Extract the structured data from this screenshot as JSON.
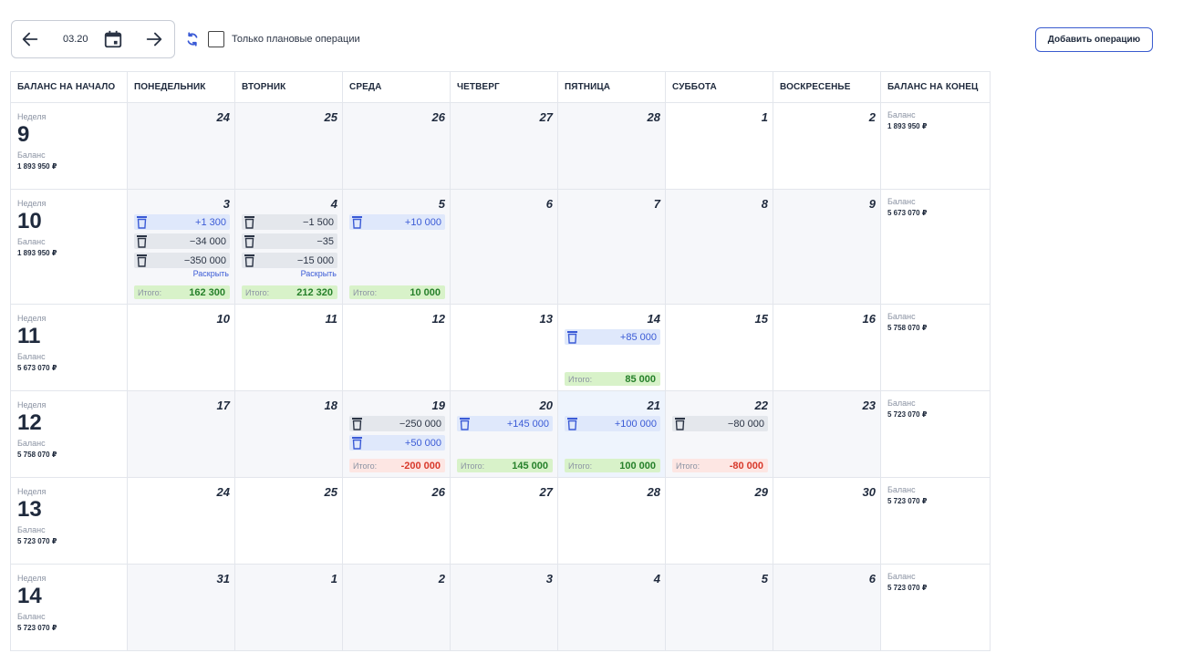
{
  "toolbar": {
    "period": "03.20",
    "only_planned_label": "Только плановые операции",
    "add_operation_label": "Добавить операцию"
  },
  "headers": [
    "БАЛАНС НА НАЧАЛО",
    "ПОНЕДЕЛЬНИК",
    "ВТОРНИК",
    "СРЕДА",
    "ЧЕТВЕРГ",
    "ПЯТНИЦА",
    "СУББОТА",
    "ВОСКРЕСЕНЬЕ",
    "БАЛАНС НА КОНЕЦ"
  ],
  "labels": {
    "week": "Неделя",
    "balance": "Баланс",
    "total": "Итого:",
    "expand": "Раскрыть"
  },
  "weeks": [
    {
      "number": "9",
      "start_balance": "1 893 950 ₽",
      "end_balance": "1 893 950 ₽",
      "days": [
        {
          "day": "24",
          "bg": "grey",
          "ops": []
        },
        {
          "day": "25",
          "bg": "grey",
          "ops": []
        },
        {
          "day": "26",
          "bg": "grey",
          "ops": []
        },
        {
          "day": "27",
          "bg": "grey",
          "ops": []
        },
        {
          "day": "28",
          "bg": "grey",
          "ops": []
        },
        {
          "day": "1",
          "bg": "white",
          "ops": []
        },
        {
          "day": "2",
          "bg": "white",
          "ops": []
        }
      ]
    },
    {
      "number": "10",
      "start_balance": "1 893 950 ₽",
      "end_balance": "5 673 070 ₽",
      "days": [
        {
          "day": "3",
          "bg": "grey",
          "ops": [
            {
              "amount": "+1 300",
              "type": "inc"
            },
            {
              "amount": "−34 000",
              "type": "exp"
            },
            {
              "amount": "−350 000",
              "type": "exp"
            }
          ],
          "expand": true,
          "total": "162 300",
          "total_type": "pos"
        },
        {
          "day": "4",
          "bg": "grey",
          "ops": [
            {
              "amount": "−1 500",
              "type": "exp"
            },
            {
              "amount": "−35",
              "type": "exp"
            },
            {
              "amount": "−15 000",
              "type": "exp"
            }
          ],
          "expand": true,
          "total": "212 320",
          "total_type": "pos"
        },
        {
          "day": "5",
          "bg": "grey",
          "ops": [
            {
              "amount": "+10 000",
              "type": "inc"
            }
          ],
          "total": "10 000",
          "total_type": "pos"
        },
        {
          "day": "6",
          "bg": "grey",
          "ops": []
        },
        {
          "day": "7",
          "bg": "grey",
          "ops": []
        },
        {
          "day": "8",
          "bg": "grey",
          "ops": []
        },
        {
          "day": "9",
          "bg": "grey",
          "ops": []
        }
      ]
    },
    {
      "number": "11",
      "start_balance": "5 673 070 ₽",
      "end_balance": "5 758 070 ₽",
      "days": [
        {
          "day": "10",
          "bg": "white",
          "ops": []
        },
        {
          "day": "11",
          "bg": "white",
          "ops": []
        },
        {
          "day": "12",
          "bg": "white",
          "ops": []
        },
        {
          "day": "13",
          "bg": "white",
          "ops": []
        },
        {
          "day": "14",
          "bg": "white",
          "ops": [
            {
              "amount": "+85 000",
              "type": "inc"
            }
          ],
          "total": "85 000",
          "total_type": "pos"
        },
        {
          "day": "15",
          "bg": "white",
          "ops": []
        },
        {
          "day": "16",
          "bg": "white",
          "ops": []
        }
      ]
    },
    {
      "number": "12",
      "start_balance": "5 758 070 ₽",
      "end_balance": "5 723 070 ₽",
      "days": [
        {
          "day": "17",
          "bg": "grey",
          "ops": []
        },
        {
          "day": "18",
          "bg": "grey",
          "ops": []
        },
        {
          "day": "19",
          "bg": "grey",
          "ops": [
            {
              "amount": "−250 000",
              "type": "exp"
            },
            {
              "amount": "+50 000",
              "type": "inc"
            }
          ],
          "total": "-200 000",
          "total_type": "neg"
        },
        {
          "day": "20",
          "bg": "grey",
          "ops": [
            {
              "amount": "+145 000",
              "type": "inc"
            }
          ],
          "total": "145 000",
          "total_type": "pos"
        },
        {
          "day": "21",
          "bg": "blue",
          "ops": [
            {
              "amount": "+100 000",
              "type": "inc"
            }
          ],
          "total": "100 000",
          "total_type": "pos"
        },
        {
          "day": "22",
          "bg": "grey",
          "ops": [
            {
              "amount": "−80 000",
              "type": "exp"
            }
          ],
          "total": "-80 000",
          "total_type": "neg"
        },
        {
          "day": "23",
          "bg": "grey",
          "ops": []
        }
      ]
    },
    {
      "number": "13",
      "start_balance": "5 723 070 ₽",
      "end_balance": "5 723 070 ₽",
      "days": [
        {
          "day": "24",
          "bg": "white",
          "ops": []
        },
        {
          "day": "25",
          "bg": "white",
          "ops": []
        },
        {
          "day": "26",
          "bg": "white",
          "ops": []
        },
        {
          "day": "27",
          "bg": "white",
          "ops": []
        },
        {
          "day": "28",
          "bg": "white",
          "ops": []
        },
        {
          "day": "29",
          "bg": "white",
          "ops": []
        },
        {
          "day": "30",
          "bg": "white",
          "ops": []
        }
      ]
    },
    {
      "number": "14",
      "start_balance": "5 723 070 ₽",
      "end_balance": "5 723 070 ₽",
      "days": [
        {
          "day": "31",
          "bg": "grey",
          "ops": []
        },
        {
          "day": "1",
          "bg": "grey",
          "ops": []
        },
        {
          "day": "2",
          "bg": "grey",
          "ops": []
        },
        {
          "day": "3",
          "bg": "grey",
          "ops": []
        },
        {
          "day": "4",
          "bg": "grey",
          "ops": []
        },
        {
          "day": "5",
          "bg": "grey",
          "ops": []
        },
        {
          "day": "6",
          "bg": "grey",
          "ops": []
        }
      ]
    }
  ]
}
